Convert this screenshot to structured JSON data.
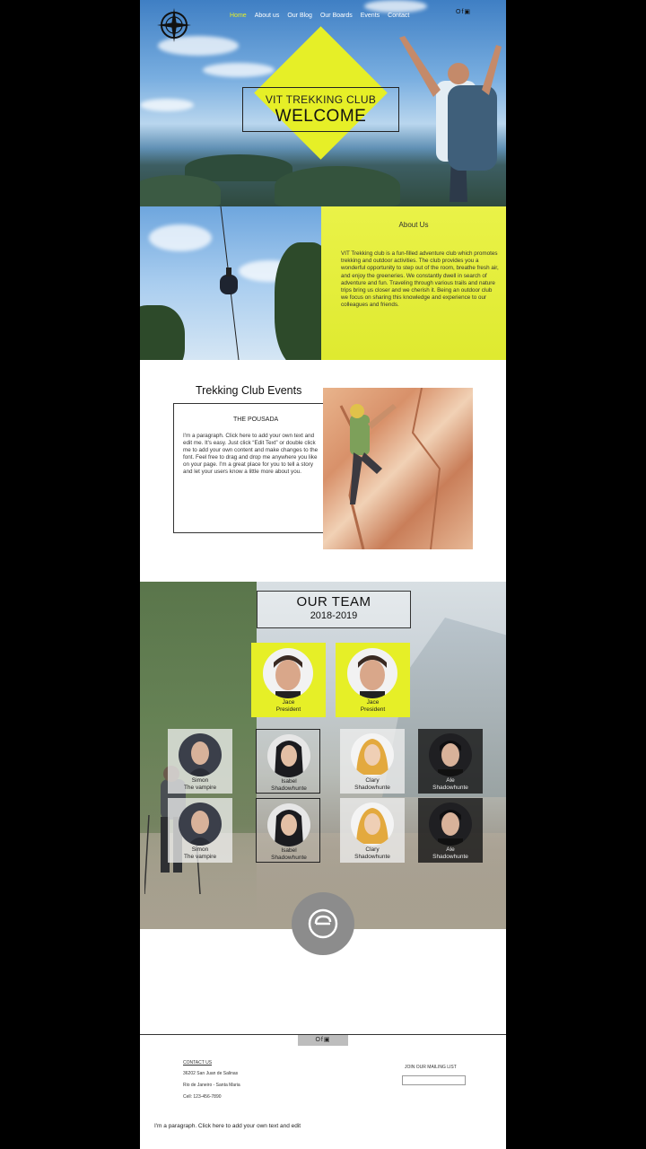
{
  "nav": {
    "items": [
      "Home",
      "About us",
      "Our Blog",
      "Our Boards",
      "Events",
      "Contact"
    ],
    "active_color": "#e6ef27",
    "social": "Of▣"
  },
  "hero": {
    "line1": "VIT TREKKING CLUB",
    "line2": "WELCOME",
    "accent": "#e6ef27"
  },
  "about": {
    "title": "About Us",
    "text": "VIT Trekking club is a fun-filled adventure club which promotes trekking and outdoor activities. The club provides you a wonderful opportunity to step out of the room, breathe fresh air, and enjoy the greeneries. We constantly dwell in search of adventure and fun. Traveling through various trails and nature trips bring us closer and we cherish it. Being an outdoor club we focus on sharing this knowledge and experience to our colleagues and friends."
  },
  "events": {
    "title": "Trekking Club Events",
    "subtitle": "THE POUSADA",
    "text": "I'm a paragraph. Click here to add your own text and edit me. It's easy. Just click “Edit Text” or double click me to add your own content and make changes to the font. Feel free to drag and drop me anywhere you like on your page. I'm a great place for you to tell a story and let your users know a little more about you."
  },
  "team": {
    "title": "OUR TEAM",
    "year": "2018-2019",
    "leaders": [
      {
        "name": "Jace",
        "role": "President"
      },
      {
        "name": "Jace",
        "role": "President"
      }
    ],
    "members": [
      {
        "name": "Simon",
        "role": "The vampire"
      },
      {
        "name": "Isabel",
        "role": "Shadowhunte"
      },
      {
        "name": "Clary",
        "role": "Shadowhunte"
      },
      {
        "name": "Ale",
        "role": "Shadowhunte"
      },
      {
        "name": "Simon",
        "role": "The vampire"
      },
      {
        "name": "Isabel",
        "role": "Shadowhunte"
      },
      {
        "name": "Clary",
        "role": "Shadowhunte"
      },
      {
        "name": "Ale",
        "role": "Shadowhunte"
      }
    ]
  },
  "footer": {
    "social": "Of▣",
    "contact_title": "CONTACT US",
    "address1": "36202 San Juan de Salinas",
    "address2": "Rio de Janeiro - Santa Maria",
    "phone": "Cell: 123-456-7890",
    "mailing_title": "JOIN OUR MAILING LIST",
    "paragraph": "I'm a paragraph. Click here to add your own text and edit"
  }
}
